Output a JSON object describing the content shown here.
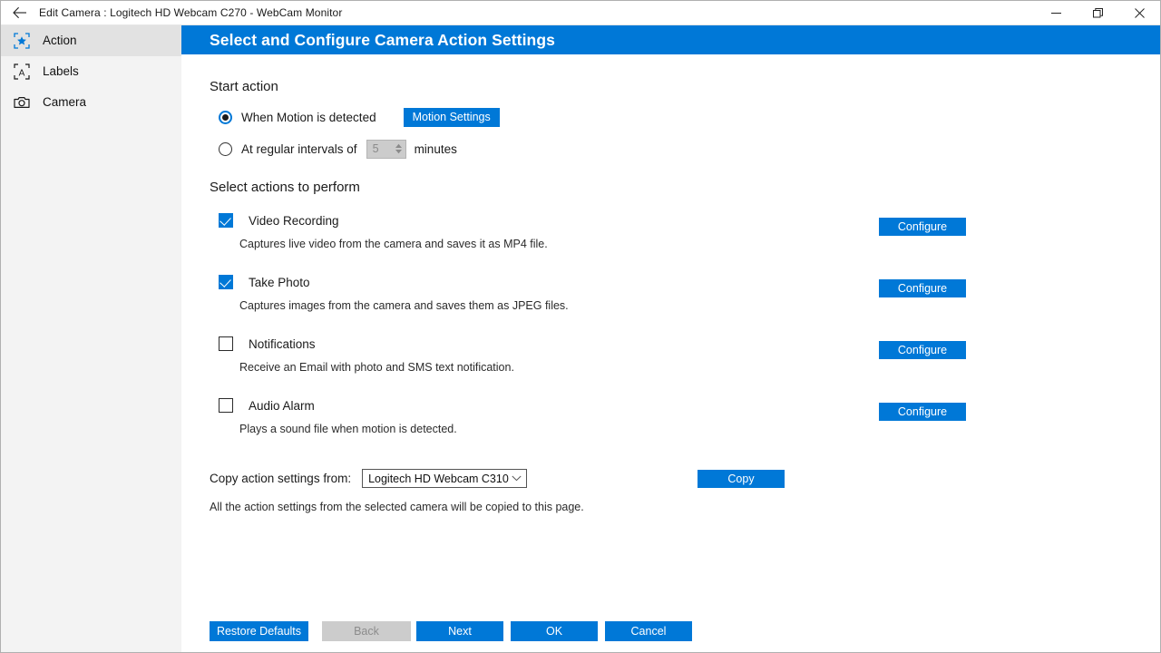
{
  "titlebar": {
    "back_icon": "back-arrow-icon",
    "title": "Edit Camera : Logitech HD Webcam C270 - WebCam Monitor",
    "minimize_label": "Minimize",
    "restore_label": "Restore",
    "close_label": "Close"
  },
  "sidebar": {
    "items": [
      {
        "label": "Action",
        "icon": "star-target-icon",
        "selected": true
      },
      {
        "label": "Labels",
        "icon": "letter-a-target-icon",
        "selected": false
      },
      {
        "label": "Camera",
        "icon": "camera-icon",
        "selected": false
      }
    ]
  },
  "header": {
    "title": "Select and Configure Camera Action Settings",
    "accent_color": "#0078d7"
  },
  "start_action": {
    "title": "Start action",
    "options": [
      {
        "label": "When Motion is detected",
        "checked": true
      },
      {
        "label": "At regular intervals of",
        "checked": false
      }
    ],
    "motion_settings_button": "Motion Settings",
    "interval_value": "5",
    "interval_unit": "minutes"
  },
  "actions": {
    "title": "Select actions to perform",
    "configure_label": "Configure",
    "items": [
      {
        "label": "Video Recording",
        "checked": true,
        "description": "Captures live video from the camera and saves it as MP4 file."
      },
      {
        "label": "Take Photo",
        "checked": true,
        "description": "Captures images from the camera and saves them as JPEG files."
      },
      {
        "label": "Notifications",
        "checked": false,
        "description": "Receive an Email with photo and SMS text notification."
      },
      {
        "label": "Audio Alarm",
        "checked": false,
        "description": "Plays a sound file when motion is detected."
      }
    ]
  },
  "copy_settings": {
    "label": "Copy action settings from:",
    "selected_camera": "Logitech HD Webcam C310",
    "copy_button": "Copy",
    "note": "All the action settings from the selected camera will be copied to this page."
  },
  "footer": {
    "restore_defaults": "Restore Defaults",
    "back": "Back",
    "back_disabled": true,
    "next": "Next",
    "ok": "OK",
    "cancel": "Cancel"
  }
}
